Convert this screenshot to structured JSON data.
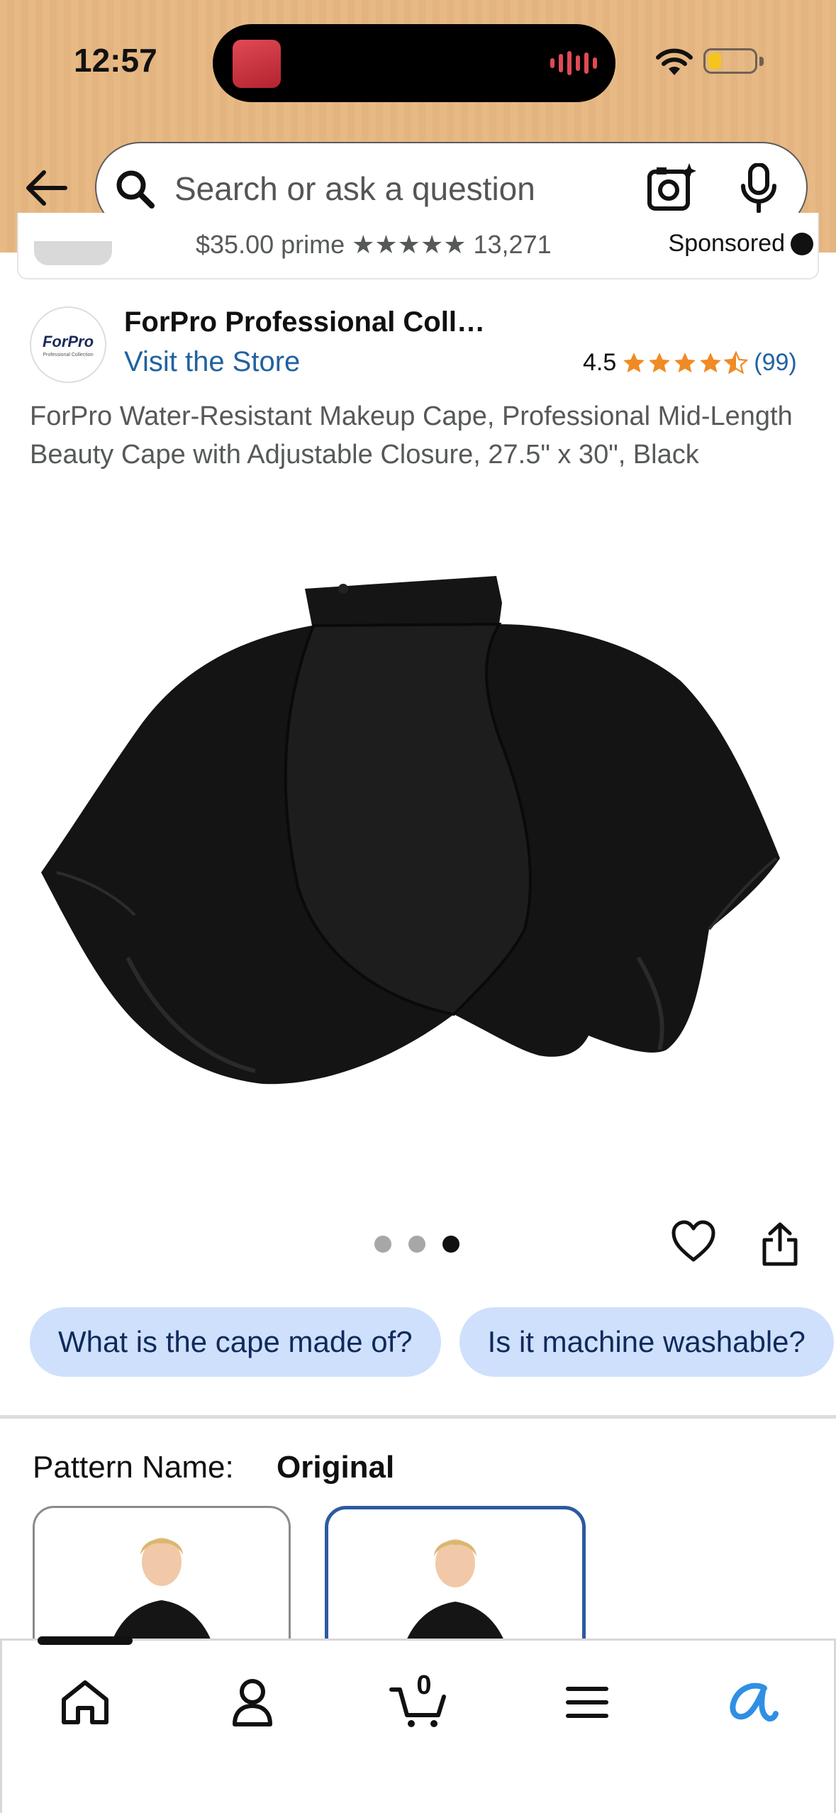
{
  "status_bar": {
    "time": "12:57",
    "battery_level": 0.2,
    "icons": [
      "wifi-icon",
      "battery-icon",
      "audio-wave-icon"
    ]
  },
  "header": {
    "search": {
      "placeholder": "Search or ask a question",
      "value": ""
    },
    "icons": [
      "back-arrow-icon",
      "search-icon",
      "camera-icon",
      "microphone-icon"
    ]
  },
  "sponsored": {
    "text": "$35.00  prime  ★★★★★ 13,271",
    "label": "Sponsored"
  },
  "brand": {
    "logo_text": "ForPro",
    "logo_subtext": "Professional Collection",
    "name": "ForPro Professional Coll…",
    "visit_store": "Visit the Store",
    "rating": "4.5",
    "rating_value": 4.5,
    "review_count": "(99)"
  },
  "product": {
    "title": "ForPro Water-Resistant Makeup Cape, Professional Mid-Length Beauty Cape with Adjustable Closure, 27.5\" x 30\", Black",
    "image_count": 3,
    "active_image": 3
  },
  "questions": [
    "What is the cape made of?",
    "Is it machine washable?"
  ],
  "pattern": {
    "label": "Pattern Name:",
    "value": "Original",
    "selected_swatch": 2
  },
  "bottom_nav": {
    "cart_count": "0",
    "items": [
      "home-icon",
      "account-icon",
      "cart-icon",
      "menu-icon",
      "rufus-icon"
    ],
    "colors": {
      "rufus": "#2f8fe3",
      "accent_link": "#2162a1",
      "star": "#f08a24",
      "chip_bg": "#cfe0fc"
    }
  }
}
